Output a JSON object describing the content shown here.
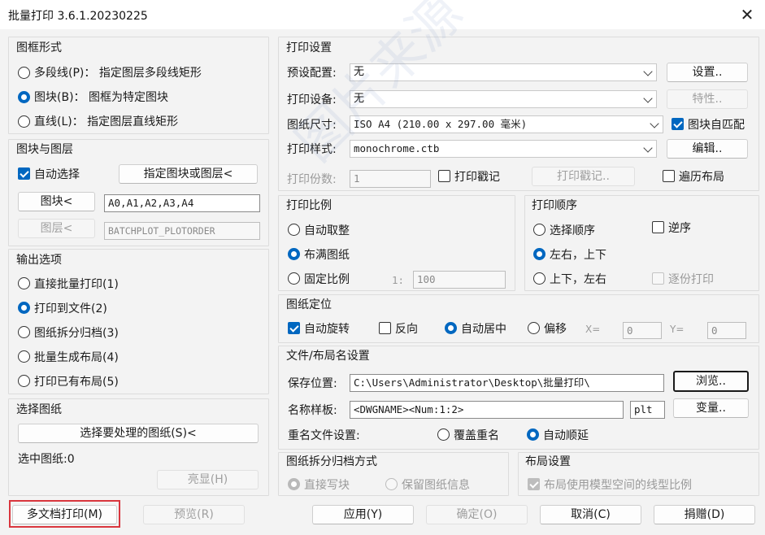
{
  "window": {
    "title": "批量打印 3.6.1.20230225",
    "close_glyph": "✕"
  },
  "frame_form": {
    "title": "图框形式",
    "options": [
      {
        "label": "多段线(P)：  指定图层多段线矩形",
        "selected": false
      },
      {
        "label": "图块(B)：  图框为特定图块",
        "selected": true
      },
      {
        "label": "直线(L)：  指定图层直线矩形",
        "selected": false
      }
    ]
  },
  "block_layer": {
    "title": "图块与图层",
    "auto_select": "自动选择",
    "specify_button": "指定图块或图层<",
    "block_button": "图块<",
    "block_value": "A0,A1,A2,A3,A4",
    "layer_button": "图层<",
    "layer_value": "BATCHPLOT_PLOTORDER"
  },
  "output": {
    "title": "输出选项",
    "options": [
      {
        "label": "直接批量打印(1)",
        "selected": false
      },
      {
        "label": "打印到文件(2)",
        "selected": true
      },
      {
        "label": "图纸拆分归档(3)",
        "selected": false
      },
      {
        "label": "批量生成布局(4)",
        "selected": false
      },
      {
        "label": "打印已有布局(5)",
        "selected": false
      }
    ]
  },
  "select_sheets": {
    "title": "选择图纸",
    "select_button": "选择要处理的图纸(S)<",
    "selected_count": "选中图纸:0",
    "highlight_button": "亮显(H)"
  },
  "print_settings": {
    "title": "打印设置",
    "preset_label": "预设配置:",
    "preset_value": "无",
    "setup_button": "设置..",
    "device_label": "打印设备:",
    "device_value": "无",
    "props_button": "特性..",
    "paper_label": "图纸尺寸:",
    "paper_value": "ISO A4 (210.00 x 297.00 毫米)",
    "auto_fit": "图块自匹配",
    "style_label": "打印样式:",
    "style_value": "monochrome.ctb",
    "edit_button": "编辑..",
    "copies_label": "打印份数:",
    "copies_value": "1",
    "stamp_check": "打印戳记",
    "stamp_button": "打印戳记..",
    "traverse_layout": "遍历布局"
  },
  "scale": {
    "title": "打印比例",
    "options": [
      {
        "label": "自动取整",
        "selected": false
      },
      {
        "label": "布满图纸",
        "selected": true
      },
      {
        "label": "固定比例",
        "selected": false
      }
    ],
    "ratio_prefix": "1:",
    "ratio_value": "100"
  },
  "order": {
    "title": "打印顺序",
    "options": [
      {
        "label": "选择顺序",
        "selected": false
      },
      {
        "label": "左右，上下",
        "selected": true
      },
      {
        "label": "上下，左右",
        "selected": false
      }
    ],
    "reverse": "逆序",
    "collate": "逐份打印"
  },
  "position": {
    "title": "图纸定位",
    "auto_rotate": "自动旋转",
    "reverse": "反向",
    "auto_center": "自动居中",
    "offset": "偏移",
    "x_label": "X=",
    "x_value": "0",
    "y_label": "Y=",
    "y_value": "0"
  },
  "file": {
    "title": "文件/布局名设置",
    "save_label": "保存位置:",
    "save_value": "C:\\Users\\Administrator\\Desktop\\批量打印\\",
    "browse_button": "浏览..",
    "name_label": "名称样板:",
    "name_value": "<DWGNAME><Num:1:2>",
    "ext_value": "plt",
    "var_button": "变量..",
    "rename_label": "重名文件设置:",
    "overwrite": "覆盖重名",
    "auto_increment": "自动顺延"
  },
  "split": {
    "title": "图纸拆分归档方式",
    "direct": "直接写块",
    "keep_info": "保留图纸信息"
  },
  "layout": {
    "title": "布局设置",
    "linetype_scale": "布局使用模型空间的线型比例"
  },
  "footer": {
    "multi_doc": "多文档打印(M)",
    "preview": "预览(R)",
    "apply": "应用(Y)",
    "ok": "确定(O)",
    "cancel": "取消(C)",
    "donate": "捐赠(D)"
  },
  "watermark": "图片来源 www.zzcad.com",
  "colors": {
    "accent": "#0067c0",
    "highlight_border": "#d9363e"
  }
}
